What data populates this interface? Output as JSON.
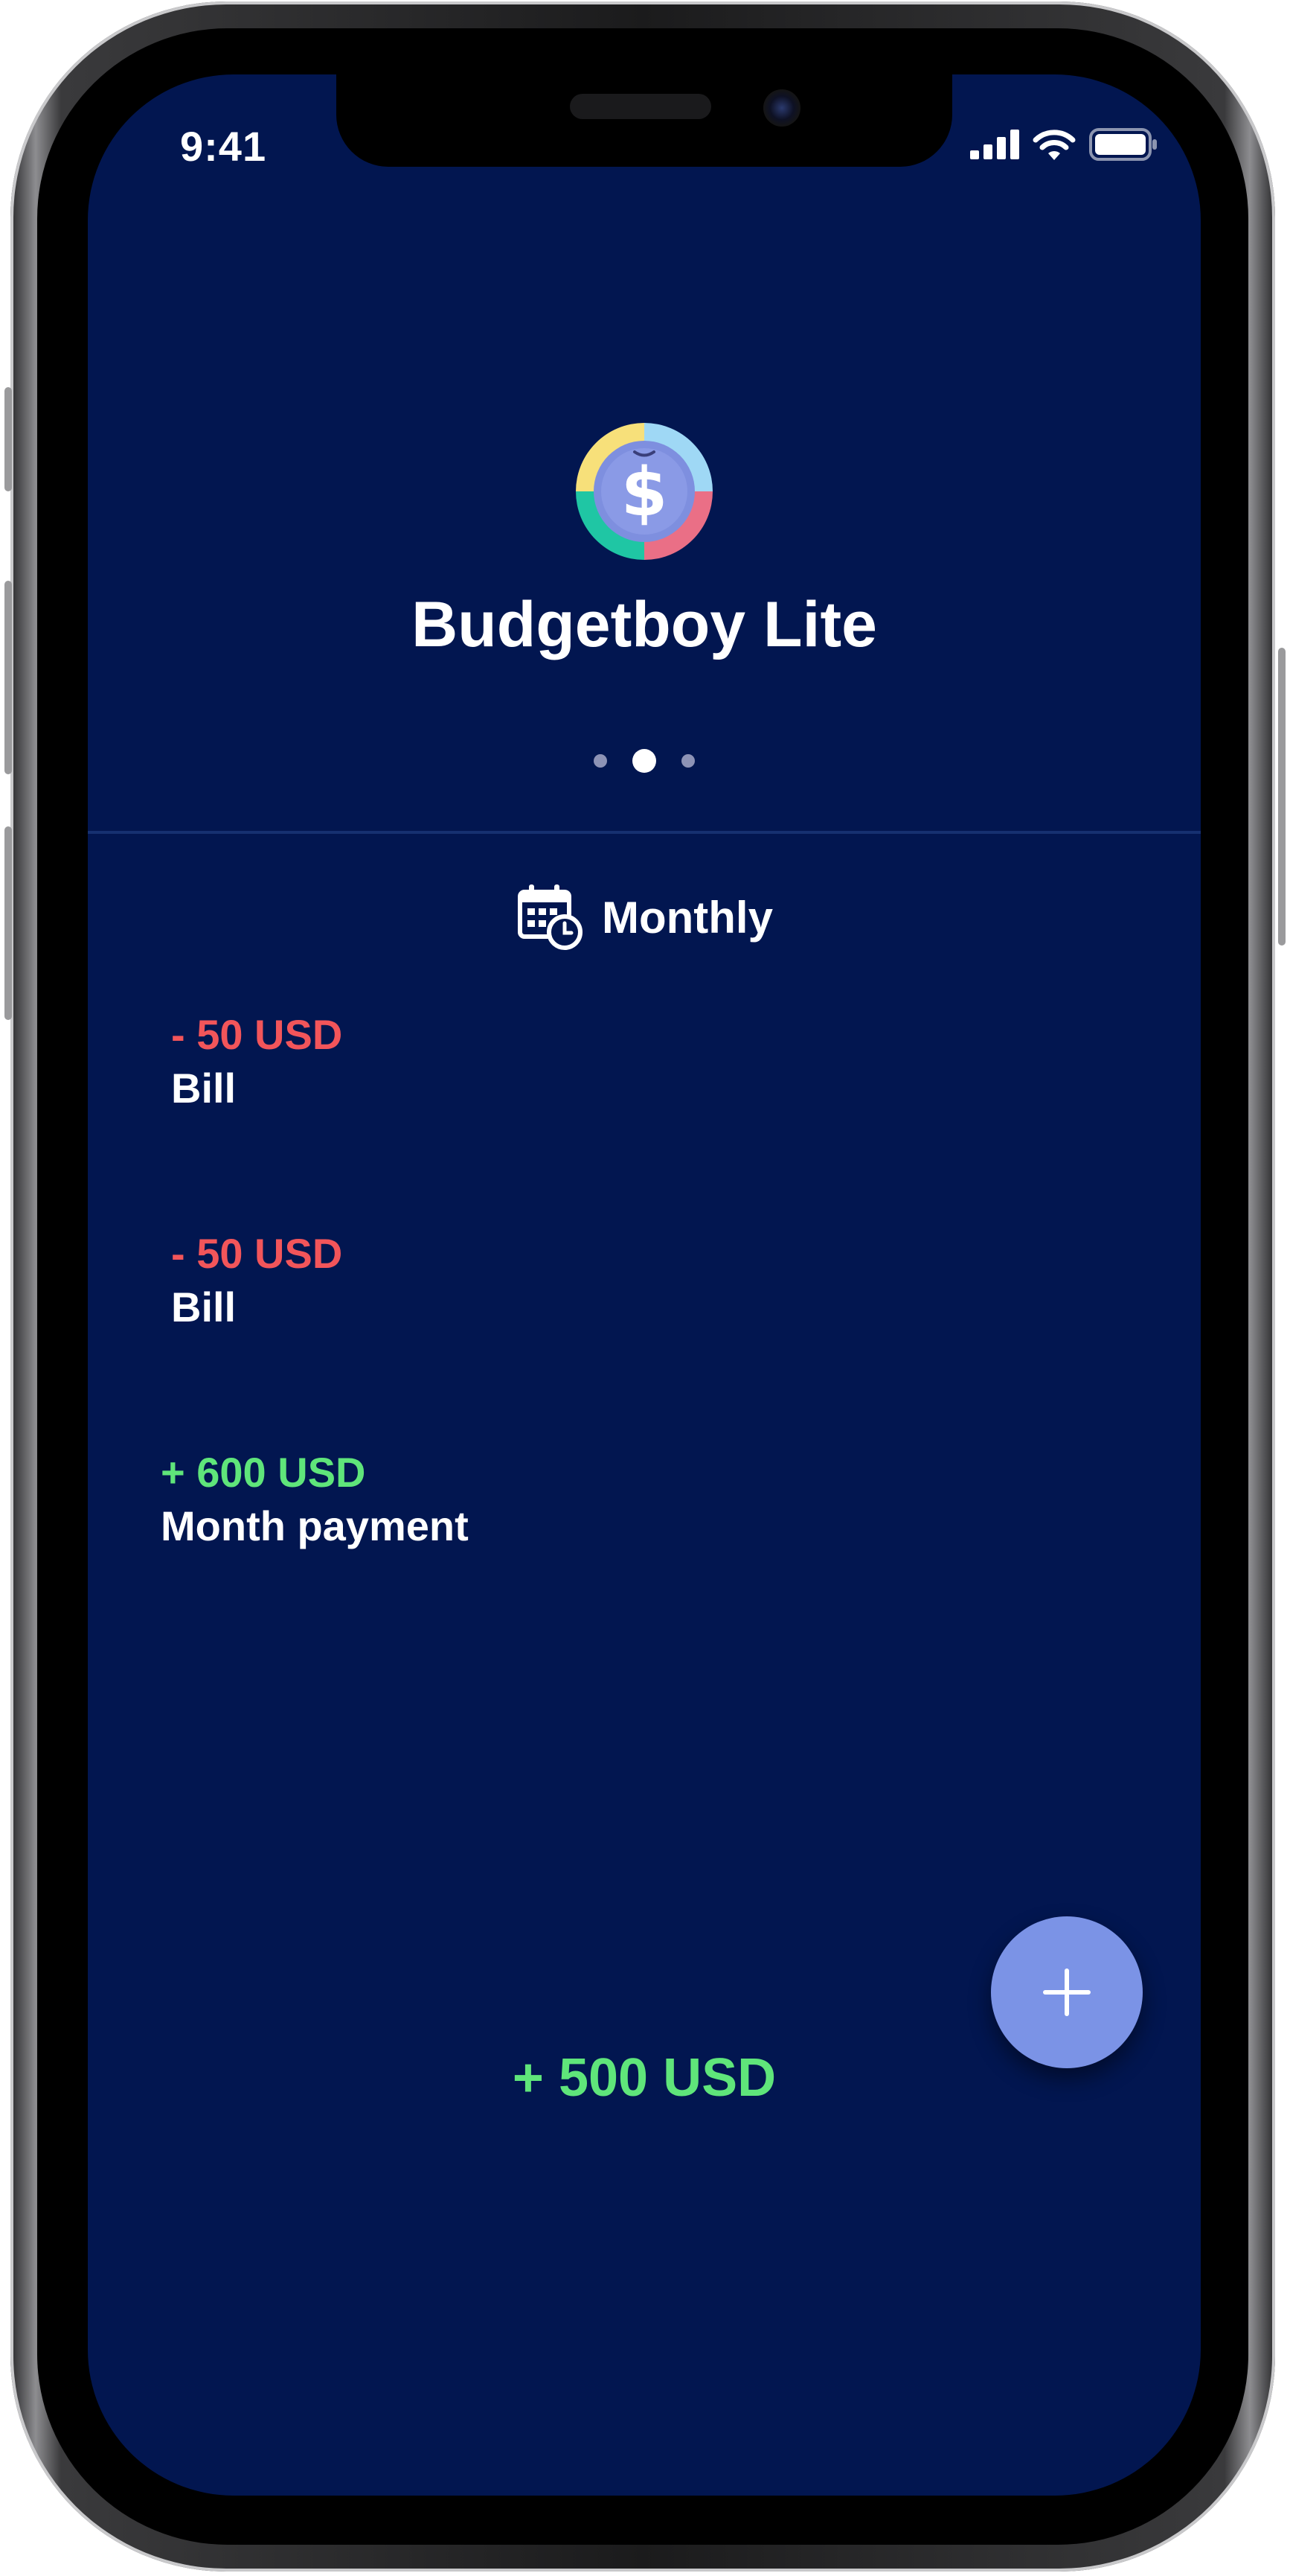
{
  "status_bar": {
    "time": "9:41",
    "icons": [
      "signal-icon",
      "wifi-icon",
      "battery-icon"
    ]
  },
  "app": {
    "title": "Budgetboy Lite",
    "logo_icon": "dollar-coin-icon",
    "pager": {
      "count": 3,
      "active_index": 1
    }
  },
  "period": {
    "icon": "calendar-clock-icon",
    "label": "Monthly"
  },
  "transactions": [
    {
      "amount": "- 50 USD",
      "label": "Bill",
      "type": "expense"
    },
    {
      "amount": "- 50 USD",
      "label": "Bill",
      "type": "expense"
    },
    {
      "amount": "+ 600 USD",
      "label": "Month payment",
      "type": "income"
    }
  ],
  "total": "+ 500 USD",
  "fab": {
    "icon": "plus-icon"
  },
  "colors": {
    "background": "#021650",
    "expense": "#f2555a",
    "income": "#5fe57a",
    "fab": "#7b93e6"
  }
}
